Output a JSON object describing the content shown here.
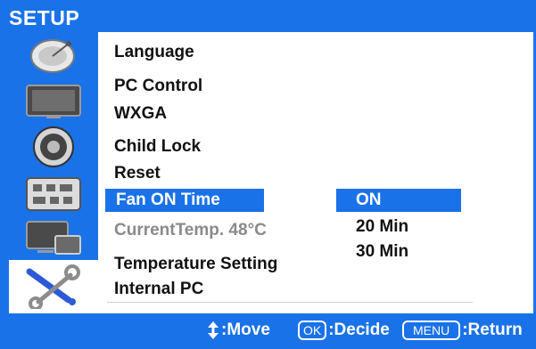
{
  "title": "SETUP",
  "colors": {
    "accent": "#1a72e8",
    "background": "#ffffff",
    "text": "#111111",
    "dim_text": "#8a8a8a"
  },
  "sidebar": {
    "items": [
      {
        "icon": "satellite-dish-icon"
      },
      {
        "icon": "monitor-icon"
      },
      {
        "icon": "speaker-icon"
      },
      {
        "icon": "connector-panel-icon"
      },
      {
        "icon": "multi-screen-icon"
      },
      {
        "icon": "tools-icon",
        "active": true
      }
    ]
  },
  "menu": {
    "language": "Language",
    "pc_control": "PC Control",
    "wxga": "WXGA",
    "child_lock": "Child Lock",
    "reset": "Reset",
    "fan_on_time": "Fan ON Time",
    "current_temp": "CurrentTemp.  48°C",
    "temperature_setting": "Temperature Setting",
    "internal_pc": "Internal PC"
  },
  "submenu": {
    "options": [
      "ON",
      "20 Min",
      "30 Min"
    ],
    "selected": "ON"
  },
  "footer": {
    "move_label": ":Move",
    "ok_key": "OK",
    "decide_label": ":Decide",
    "menu_key": "MENU",
    "return_label": ":Return"
  }
}
